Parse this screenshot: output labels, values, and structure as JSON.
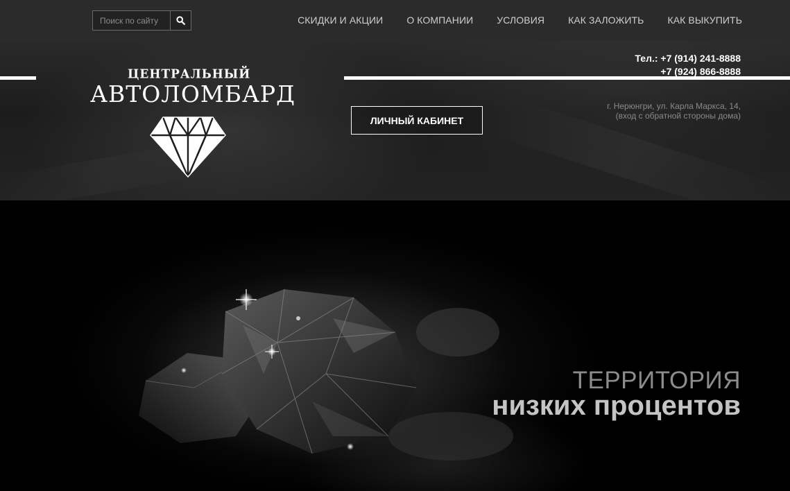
{
  "search": {
    "placeholder": "Поиск по сайту",
    "icon": "search-icon"
  },
  "nav": {
    "items": [
      "СКИДКИ И АКЦИИ",
      "О КОМПАНИИ",
      "УСЛОВИЯ",
      "КАК ЗАЛОЖИТЬ",
      "КАК ВЫКУПИТЬ"
    ]
  },
  "logo": {
    "line1": "ЦЕНТРАЛЬНЫЙ",
    "line2": "АВТОЛОМБАРД",
    "icon": "diamond-icon"
  },
  "contacts": {
    "phone1": "Тел.: +7 (914) 241-8888",
    "phone2": "+7 (924) 866-8888",
    "address1": "г. Нерюнгри, ул. Карла Маркса, 14,",
    "address2": "(вход с обратной стороны дома)"
  },
  "cabinet_button": "ЛИЧНЫЙ КАБИНЕТ",
  "hero": {
    "line1": "ТЕРРИТОРИЯ",
    "line2": "низких процентов"
  },
  "colors": {
    "topbar": "#2b2b2b",
    "nav_text": "#cfcfcf",
    "hero_text_light": "#c4c4c4",
    "hero_text_dim": "#8c8c8c"
  }
}
